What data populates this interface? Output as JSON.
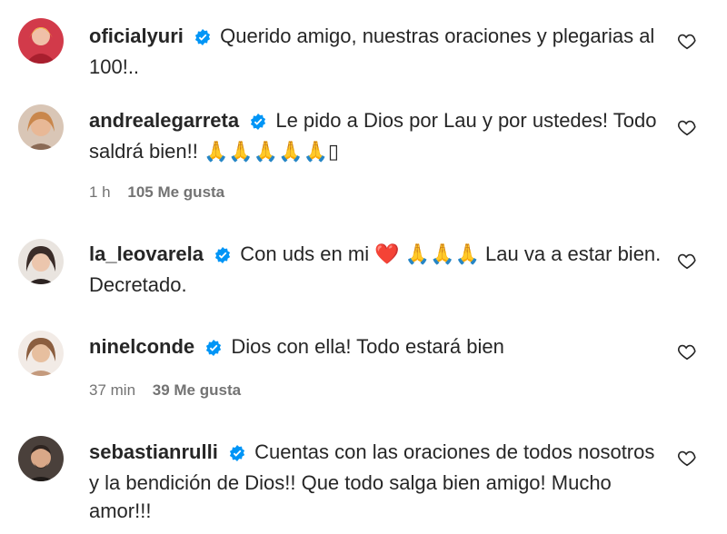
{
  "comments": [
    {
      "username": "oficialyuri",
      "text": "Querido amigo, nuestras oraciones y plegarias al 100!..",
      "avatar_color": "#d23a4a"
    },
    {
      "username": "andrealegarreta",
      "text": "Le pido a Dios por Lau y por ustedes! Todo saldrá bien!! 🙏🙏🙏🙏🙏▯",
      "time": "1 h",
      "likes": "105 Me gusta",
      "avatar_color": "#c9a07a"
    },
    {
      "username": "la_leovarela",
      "text_before": "Con uds en mi",
      "heart_emoji": "❤️",
      "text_after": "🙏🙏🙏 Lau va a estar bien. Decretado.",
      "avatar_color": "#4a3b35"
    },
    {
      "username": "ninelconde",
      "text": "Dios con ella! Todo estará bien",
      "time": "37 min",
      "likes": "39 Me gusta",
      "avatar_color": "#b99177"
    },
    {
      "username": "sebastianrulli",
      "text": "Cuentas con las oraciones de todos nosotros y la bendición de Dios!! Que todo salga bien amigo! Mucho amor!!!",
      "avatar_color": "#6a5a50"
    }
  ],
  "colors": {
    "verified": "#0095f6",
    "secondary": "#737373",
    "heart_red": "#e0232f"
  },
  "icons": {
    "verified": "verified-badge-icon",
    "like": "heart-outline-icon"
  }
}
